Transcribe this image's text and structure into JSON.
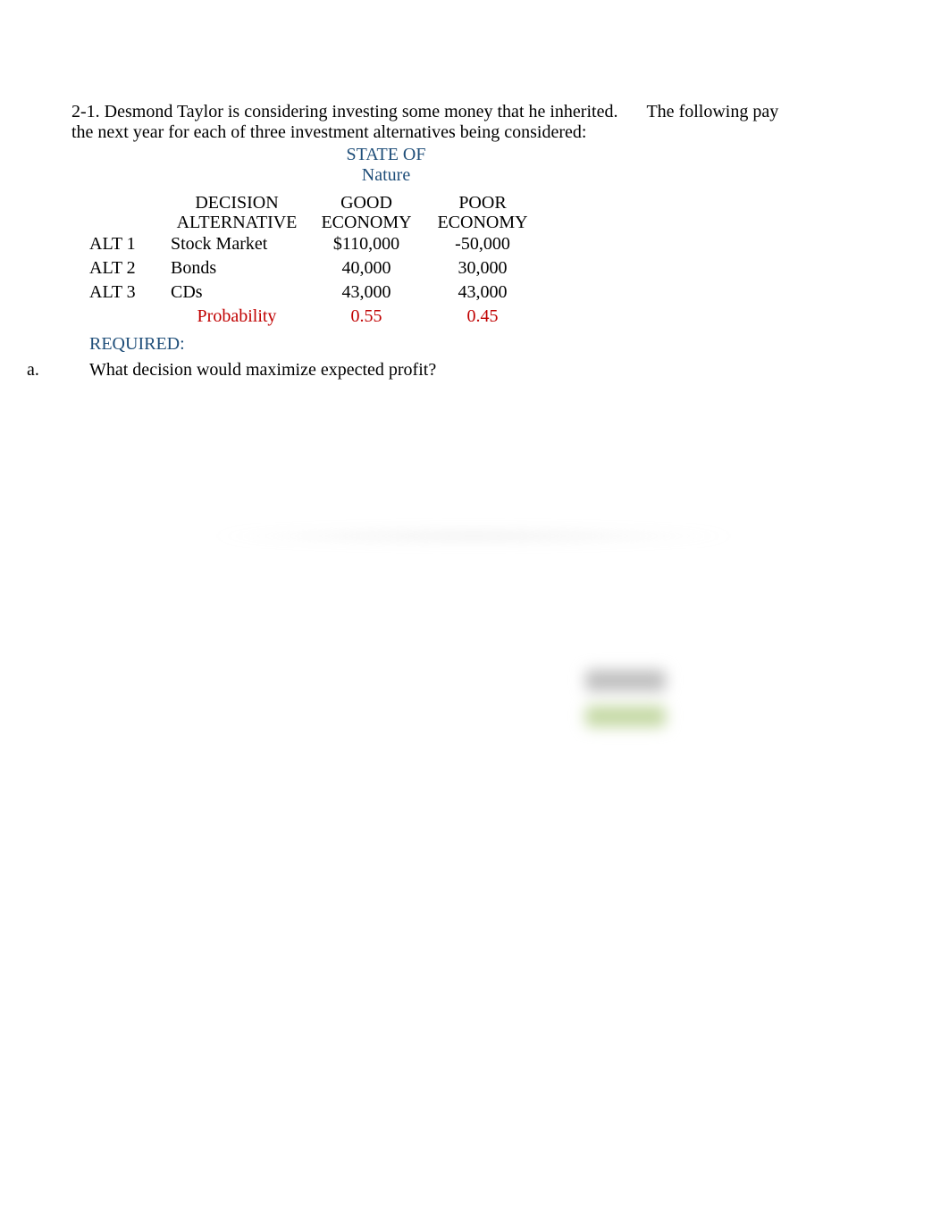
{
  "intro": {
    "line1_part1": "2-1.  Desmond Taylor is considering investing some money that he inherited.",
    "line1_part2": "The following pay",
    "line2": "the next year for each of three investment alternatives being considered:"
  },
  "state_header": {
    "line1": "STATE OF",
    "line2": "Nature"
  },
  "table": {
    "headers": {
      "decision_line1": "DECISION",
      "decision_line2": "ALTERNATIVE",
      "good_line1": "GOOD",
      "good_line2": "ECONOMY",
      "poor_line1": "POOR",
      "poor_line2": "ECONOMY"
    },
    "rows": [
      {
        "label": "ALT 1",
        "decision": "Stock Market",
        "good": "$110,000",
        "poor": "-50,000"
      },
      {
        "label": "ALT 2",
        "decision": "Bonds",
        "good": "40,000",
        "poor": "30,000"
      },
      {
        "label": "ALT 3",
        "decision": "CDs",
        "good": "43,000",
        "poor": "43,000"
      }
    ],
    "probability": {
      "label": "Probability",
      "good": "0.55",
      "poor": "0.45"
    }
  },
  "required_label": "REQUIRED:",
  "question": {
    "letter": "a.",
    "text": "What decision would maximize expected profit?"
  }
}
